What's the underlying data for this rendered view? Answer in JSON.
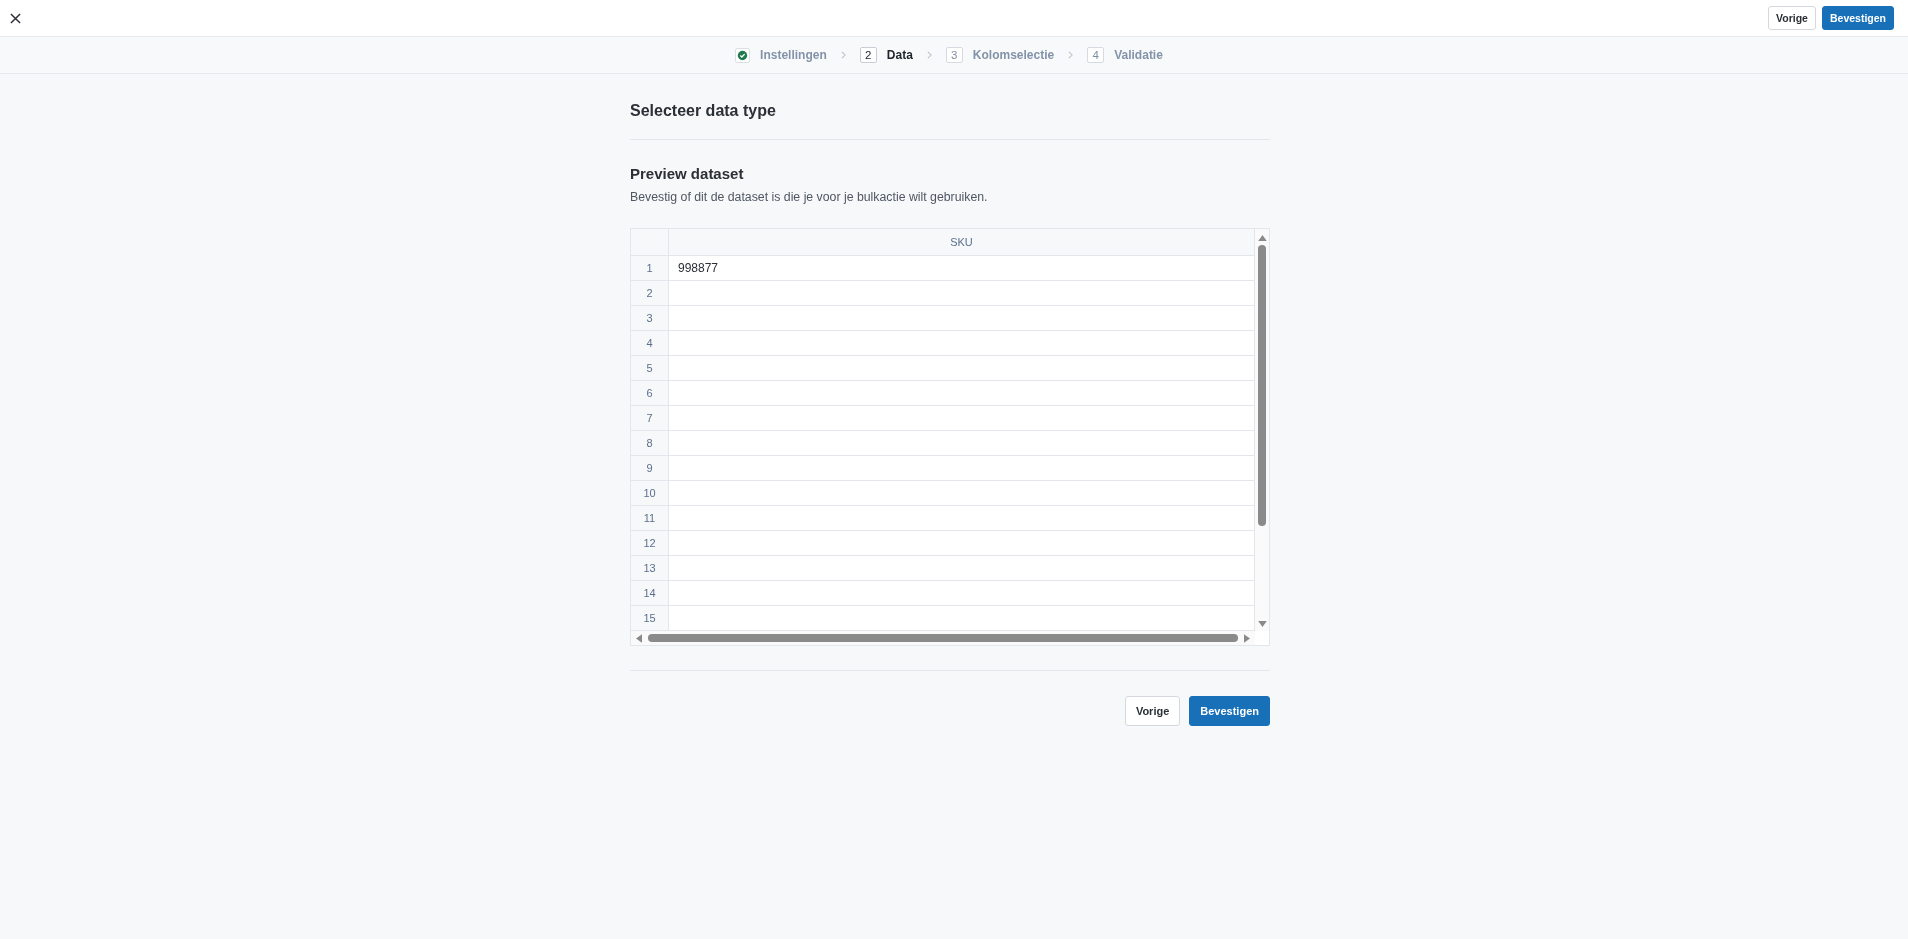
{
  "top_bar": {
    "buttons": [
      {
        "label": "Vorige",
        "kind": "secondary"
      },
      {
        "label": "Bevestigen",
        "kind": "primary"
      }
    ]
  },
  "stepper": {
    "steps": [
      {
        "label": "Instellingen",
        "completed": true,
        "selected": false
      },
      {
        "number": "2",
        "label": "Data",
        "completed": false,
        "selected": true
      },
      {
        "number": "3",
        "label": "Kolomselectie",
        "completed": false,
        "selected": false
      },
      {
        "number": "4",
        "label": "Validatie",
        "completed": false,
        "selected": false
      }
    ]
  },
  "section": {
    "title": "Selecteer data type"
  },
  "preview": {
    "title": "Preview dataset",
    "description": "Bevestig of dit de dataset is die je voor je bulkactie wilt gebruiken.",
    "table": {
      "columns": [
        "SKU"
      ],
      "rows": [
        {
          "number": "1",
          "values": [
            "998877"
          ]
        },
        {
          "number": "2"
        },
        {
          "number": "3"
        },
        {
          "number": "4"
        },
        {
          "number": "5"
        },
        {
          "number": "6"
        },
        {
          "number": "7"
        },
        {
          "number": "8"
        },
        {
          "number": "9"
        },
        {
          "number": "10"
        },
        {
          "number": "11"
        },
        {
          "number": "12"
        },
        {
          "number": "13"
        },
        {
          "number": "14"
        },
        {
          "number": "15"
        }
      ]
    }
  },
  "footer": {
    "buttons": [
      {
        "label": "Vorige",
        "kind": "secondary"
      },
      {
        "label": "Bevestigen",
        "kind": "primary"
      }
    ]
  }
}
